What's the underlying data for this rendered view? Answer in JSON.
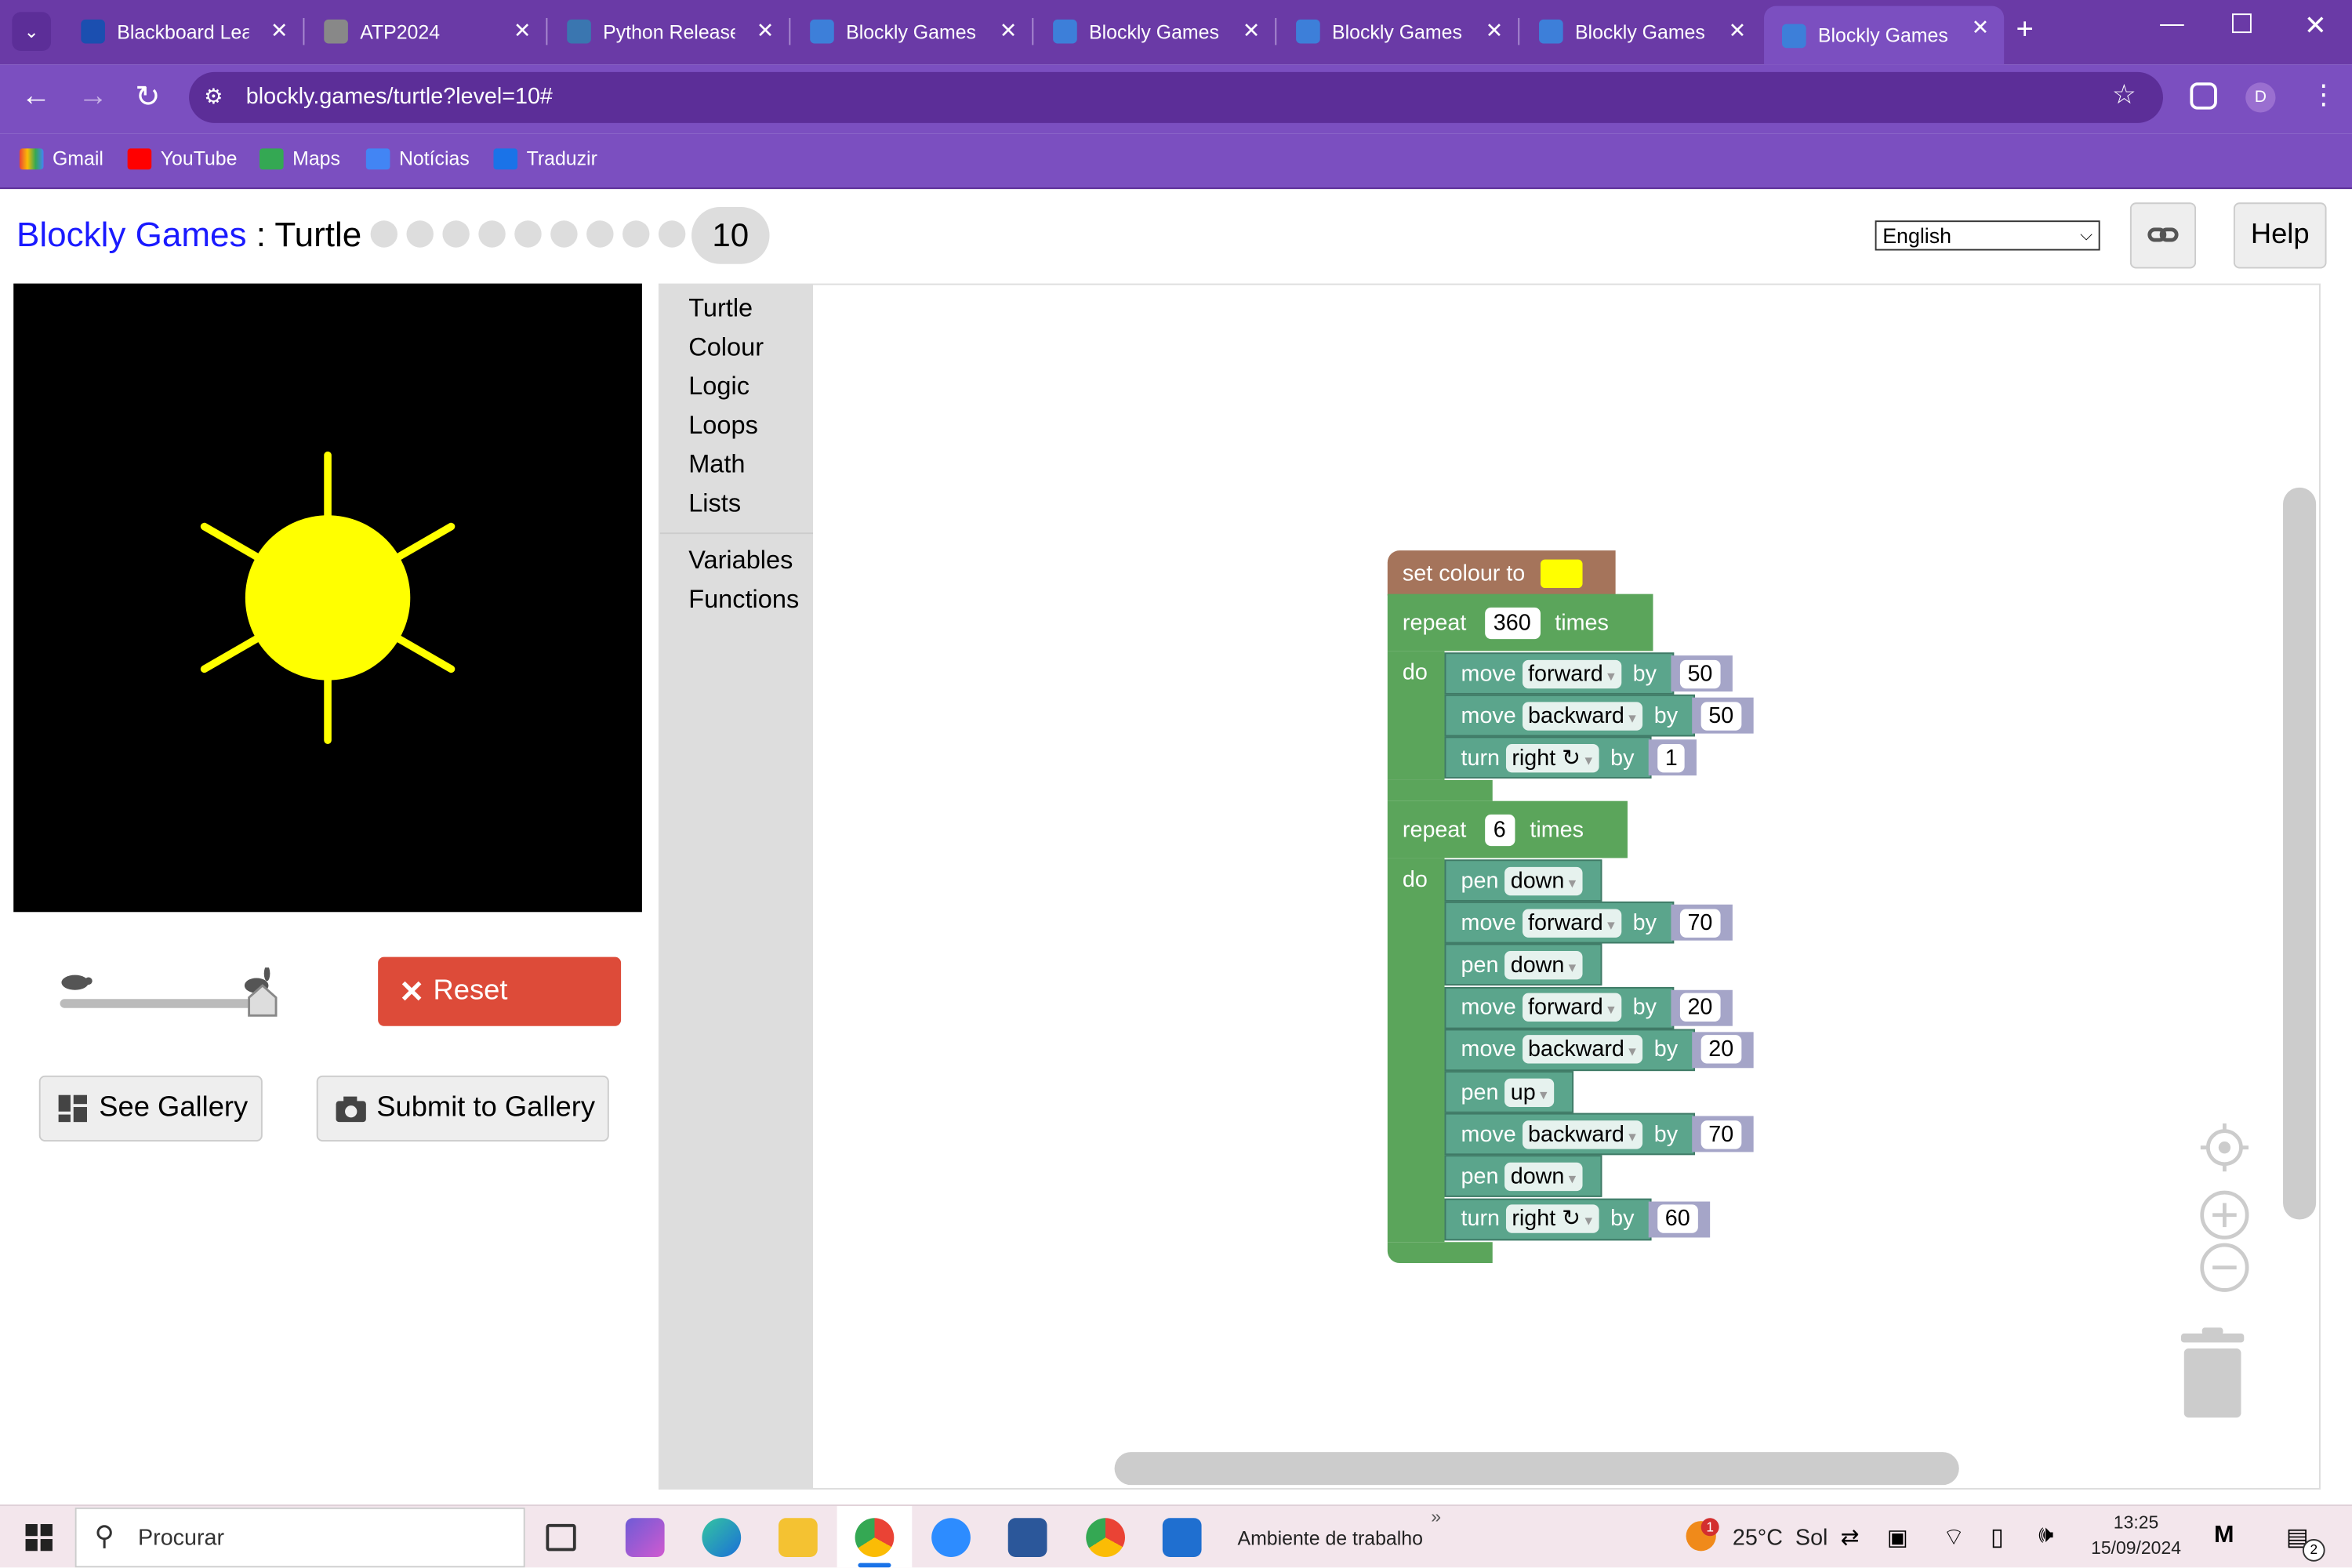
{
  "browser": {
    "tabs": [
      {
        "title": "Blackboard Lear",
        "icon": "blackboard-icon"
      },
      {
        "title": "ATP2024",
        "icon": "globe-icon"
      },
      {
        "title": "Python Release",
        "icon": "python-icon"
      },
      {
        "title": "Blockly Games :",
        "icon": "blockly-icon"
      },
      {
        "title": "Blockly Games :",
        "icon": "blockly-icon"
      },
      {
        "title": "Blockly Games :",
        "icon": "blockly-icon"
      },
      {
        "title": "Blockly Games :",
        "icon": "blockly-icon"
      },
      {
        "title": "Blockly Games :",
        "icon": "blockly-icon"
      }
    ],
    "url": "blockly.games/turtle?level=10#",
    "profile_initial": "D",
    "bookmarks": [
      "Gmail",
      "YouTube",
      "Maps",
      "Notícias",
      "Traduzir"
    ]
  },
  "page": {
    "brand": "Blockly Games",
    "separator": " : ",
    "game": "Turtle",
    "current_level": "10",
    "language": "English",
    "help_label": "Help",
    "reset_label": "Reset",
    "gallery_label": "See Gallery",
    "submit_label": "Submit to Gallery",
    "speed_level": 1.0
  },
  "toolbox": {
    "categories": [
      "Turtle",
      "Colour",
      "Logic",
      "Loops",
      "Math",
      "Lists"
    ],
    "custom": [
      "Variables",
      "Functions"
    ]
  },
  "blocks": {
    "set_colour": "set colour to",
    "colour_value": "#ffff00",
    "repeat1": {
      "kw": "repeat",
      "count": "360",
      "times": "times",
      "do": "do"
    },
    "repeat2": {
      "kw": "repeat",
      "count": "6",
      "times": "times",
      "do": "do"
    },
    "body1": [
      {
        "a": "move",
        "dd": "forward",
        "b": "by",
        "v": "50"
      },
      {
        "a": "move",
        "dd": "backward",
        "b": "by",
        "v": "50"
      },
      {
        "a": "turn",
        "dd": "right ↻",
        "b": "by",
        "v": "1"
      }
    ],
    "body2": [
      {
        "a": "pen",
        "dd": "down"
      },
      {
        "a": "move",
        "dd": "forward",
        "b": "by",
        "v": "70"
      },
      {
        "a": "pen",
        "dd": "down"
      },
      {
        "a": "move",
        "dd": "forward",
        "b": "by",
        "v": "20"
      },
      {
        "a": "move",
        "dd": "backward",
        "b": "by",
        "v": "20"
      },
      {
        "a": "pen",
        "dd": "up"
      },
      {
        "a": "move",
        "dd": "backward",
        "b": "by",
        "v": "70"
      },
      {
        "a": "pen",
        "dd": "down"
      },
      {
        "a": "turn",
        "dd": "right ↻",
        "b": "by",
        "v": "60"
      }
    ]
  },
  "taskbar": {
    "search_placeholder": "Procurar",
    "desktop_label": "Ambiente de trabalho",
    "weather": "25°C  Sol",
    "weather_badge": "1",
    "time": "13:25",
    "date": "15/09/2024",
    "notif_count": "2"
  }
}
